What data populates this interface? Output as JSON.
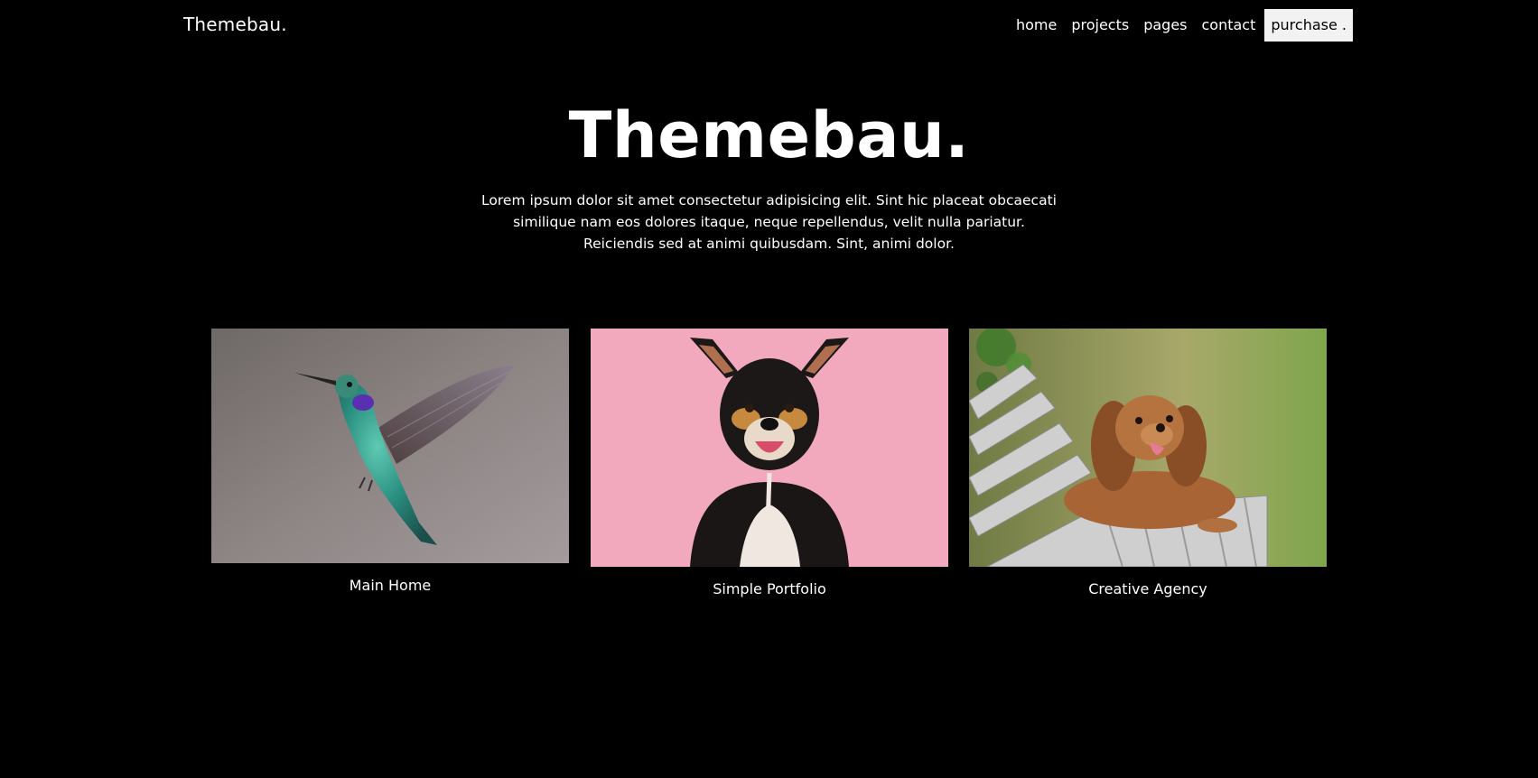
{
  "brand": "Themebau.",
  "nav": {
    "home": "home",
    "projects": "projects",
    "pages": "pages",
    "contact": "contact",
    "purchase": "purchase ."
  },
  "hero": {
    "title": "Themebau.",
    "text": "Lorem ipsum dolor sit amet consectetur adipisicing elit. Sint hic placeat obcaecati similique nam eos dolores itaque, neque repellendus, velit nulla pariatur. Reiciendis sed at animi quibusdam. Sint, animi dolor."
  },
  "cards": [
    {
      "label": "Main Home",
      "image": "hummingbird-photo"
    },
    {
      "label": "Simple Portfolio",
      "image": "dog-on-pink-photo"
    },
    {
      "label": "Creative Agency",
      "image": "spaniel-on-bench-photo"
    }
  ]
}
